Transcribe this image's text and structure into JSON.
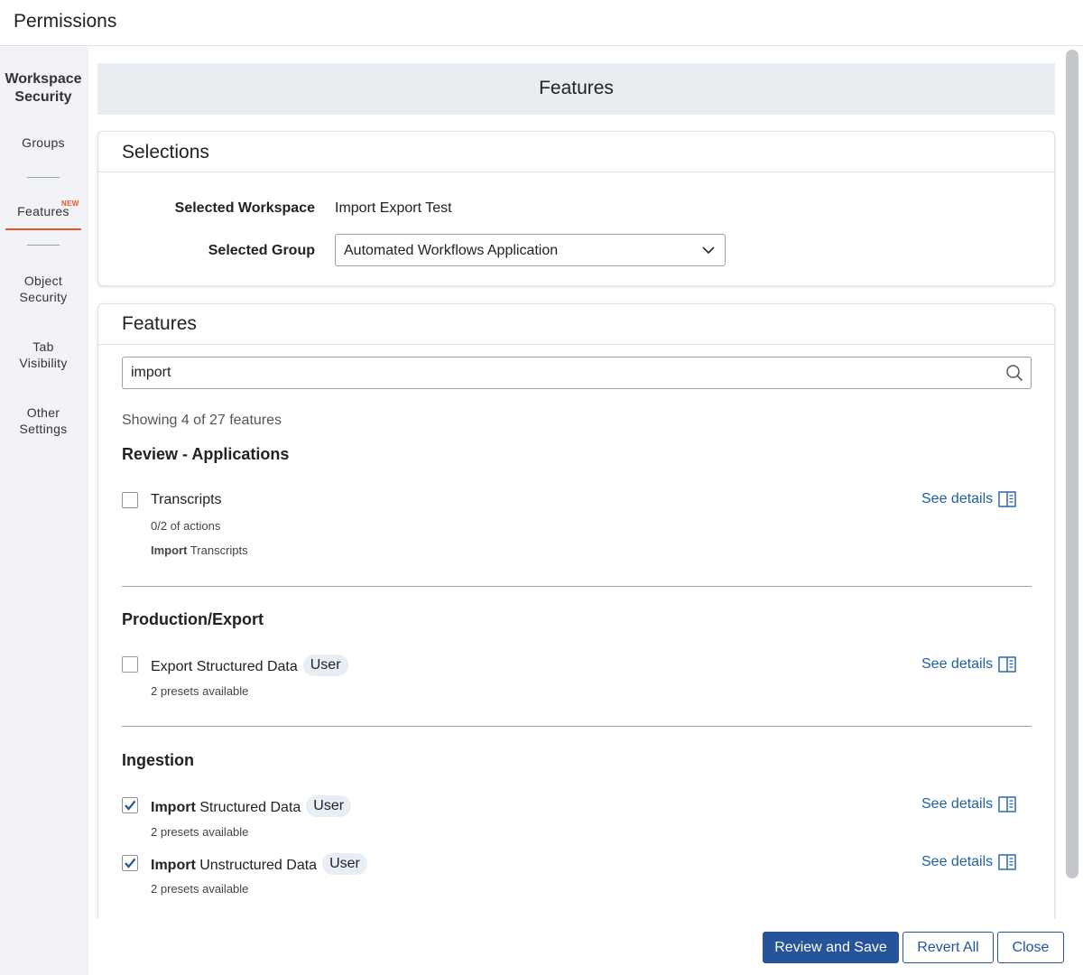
{
  "window": {
    "title": "Permissions"
  },
  "sidebar": {
    "heading_line1": "Workspace",
    "heading_line2": "Security",
    "items": [
      {
        "label": "Groups"
      },
      {
        "label": "Features",
        "badge": "NEW",
        "active": true
      },
      {
        "label_line1": "Object",
        "label_line2": "Security"
      },
      {
        "label_line1": "Tab",
        "label_line2": "Visibility"
      },
      {
        "label_line1": "Other",
        "label_line2": "Settings"
      }
    ]
  },
  "banner": {
    "title": "Features"
  },
  "selections": {
    "title": "Selections",
    "workspace_label": "Selected Workspace",
    "workspace_value": "Import Export Test",
    "group_label": "Selected Group",
    "group_value": "Automated Workflows Application"
  },
  "features": {
    "title": "Features",
    "search_value": "import",
    "showing_text": "Showing 4 of 27 features",
    "sections": [
      {
        "title": "Review - Applications",
        "items": [
          {
            "name": "Transcripts",
            "checked": false,
            "sub1": "0/2 of actions",
            "sub2_bold": "Import",
            "sub2_rest": " Transcripts",
            "details": "See details"
          }
        ]
      },
      {
        "title": "Production/Export",
        "items": [
          {
            "name": "Export Structured Data",
            "tag": "User",
            "checked": false,
            "sub1": "2 presets available",
            "details": "See details"
          }
        ]
      },
      {
        "title": "Ingestion",
        "items": [
          {
            "name_bold": "Import",
            "name_rest": " Structured Data",
            "tag": "User",
            "checked": true,
            "sub1": "2 presets available",
            "details": "See details"
          },
          {
            "name_bold": "Import",
            "name_rest": " Unstructured Data",
            "tag": "User",
            "checked": true,
            "sub1": "2 presets available",
            "details": "See details"
          }
        ]
      }
    ]
  },
  "footer": {
    "review_save": "Review and Save",
    "revert_all": "Revert All",
    "close": "Close"
  },
  "colors": {
    "accent": "#25549a",
    "link": "#1e5fa8",
    "active_tab": "#e0552a",
    "tag_bg": "#e8eef5"
  },
  "icons": {
    "search": "search-icon",
    "dropdown": "chevron-down-icon",
    "details": "book-icon",
    "check": "check-icon"
  }
}
